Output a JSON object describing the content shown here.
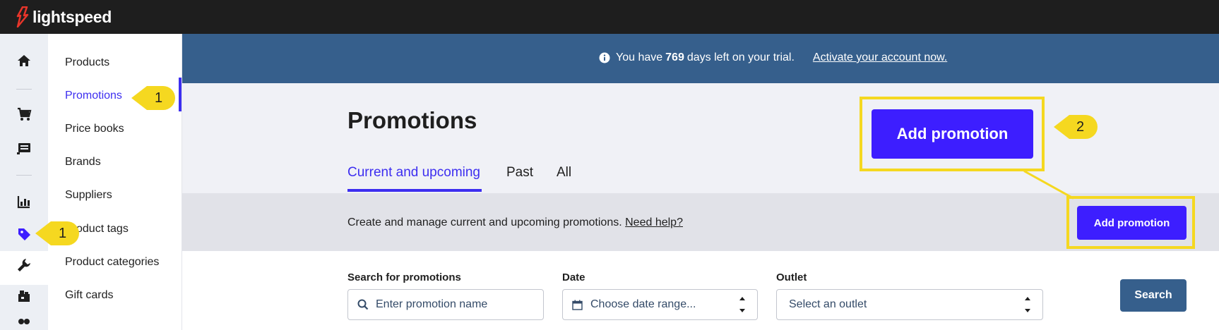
{
  "app": {
    "brand": "lightspeed"
  },
  "subnav": {
    "items": [
      {
        "label": "Products"
      },
      {
        "label": "Promotions"
      },
      {
        "label": "Price books"
      },
      {
        "label": "Brands"
      },
      {
        "label": "Suppliers"
      },
      {
        "label": "Product tags"
      },
      {
        "label": "Product categories"
      },
      {
        "label": "Gift cards"
      }
    ]
  },
  "rail": {
    "icons": [
      "home-icon",
      "cart-icon",
      "register-icon",
      "reports-icon",
      "tag-icon",
      "wrench-icon",
      "store-icon",
      "customers-icon"
    ]
  },
  "banner": {
    "text_before": "You have",
    "days": "769",
    "text_after": "days left on your trial.",
    "link": "Activate your account now."
  },
  "page": {
    "title": "Promotions",
    "tabs": [
      {
        "label": "Current and upcoming"
      },
      {
        "label": "Past"
      },
      {
        "label": "All"
      }
    ],
    "description": "Create and manage current and upcoming promotions.",
    "help_link": "Need help?",
    "add_button": "Add promotion",
    "add_button_zoomed": "Add promotion"
  },
  "filters": {
    "search_label": "Search for promotions",
    "search_placeholder": "Enter promotion name",
    "date_label": "Date",
    "date_placeholder": "Choose date range...",
    "outlet_label": "Outlet",
    "outlet_placeholder": "Select an outlet",
    "search_button": "Search"
  },
  "annotations": {
    "callout_subnav": "1",
    "callout_rail": "1",
    "callout_button": "2"
  },
  "colors": {
    "accent": "#3d1eff",
    "banner": "#365f8c",
    "highlight": "#f5d820",
    "topbar": "#1e1e1e"
  }
}
